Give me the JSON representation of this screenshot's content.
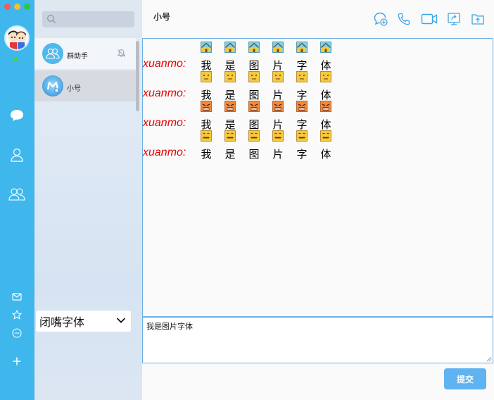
{
  "window": {
    "controls": [
      "close",
      "minimize",
      "maximize"
    ]
  },
  "rail": {
    "user_avatar_icon": "cartoon-couple-avatar",
    "status_color": "#3ed54a",
    "nav_icons": [
      "chat-bubble-icon",
      "contact-icon",
      "group-icon"
    ],
    "bottom_icons": [
      "mail-icon",
      "star-icon",
      "more-icon",
      "plus-icon"
    ]
  },
  "conversations": [
    {
      "name": "群助手",
      "avatar_icon": "group-icon",
      "muted": true
    },
    {
      "name": "小号",
      "avatar_icon": "user-avatar",
      "selected": true
    }
  ],
  "font_select": {
    "value": "闭嘴字体"
  },
  "chat": {
    "title": "小号",
    "header_actions": [
      "add-chat-icon",
      "phone-icon",
      "video-icon",
      "share-screen-icon",
      "file-upload-icon"
    ],
    "messages": [
      {
        "sender": "xuanmo:",
        "emoji": "house-face",
        "chars": [
          "我",
          "是",
          "图",
          "片",
          "字",
          "体"
        ]
      },
      {
        "sender": "xuanmo:",
        "emoji": "plain-face",
        "chars": [
          "我",
          "是",
          "图",
          "片",
          "字",
          "体"
        ]
      },
      {
        "sender": "xuanmo:",
        "emoji": "angry-face",
        "chars": [
          "我",
          "是",
          "图",
          "片",
          "字",
          "体"
        ]
      },
      {
        "sender": "xuanmo:",
        "emoji": "zipper-face",
        "chars": [
          "我",
          "是",
          "图",
          "片",
          "字",
          "体"
        ]
      }
    ],
    "composer_text": "我是图片字体",
    "submit_label": "提交"
  },
  "colors": {
    "rail": "#3fb6ec",
    "accent": "#5fb3f0",
    "sender": "#e60000",
    "border": "#6aaee6"
  }
}
